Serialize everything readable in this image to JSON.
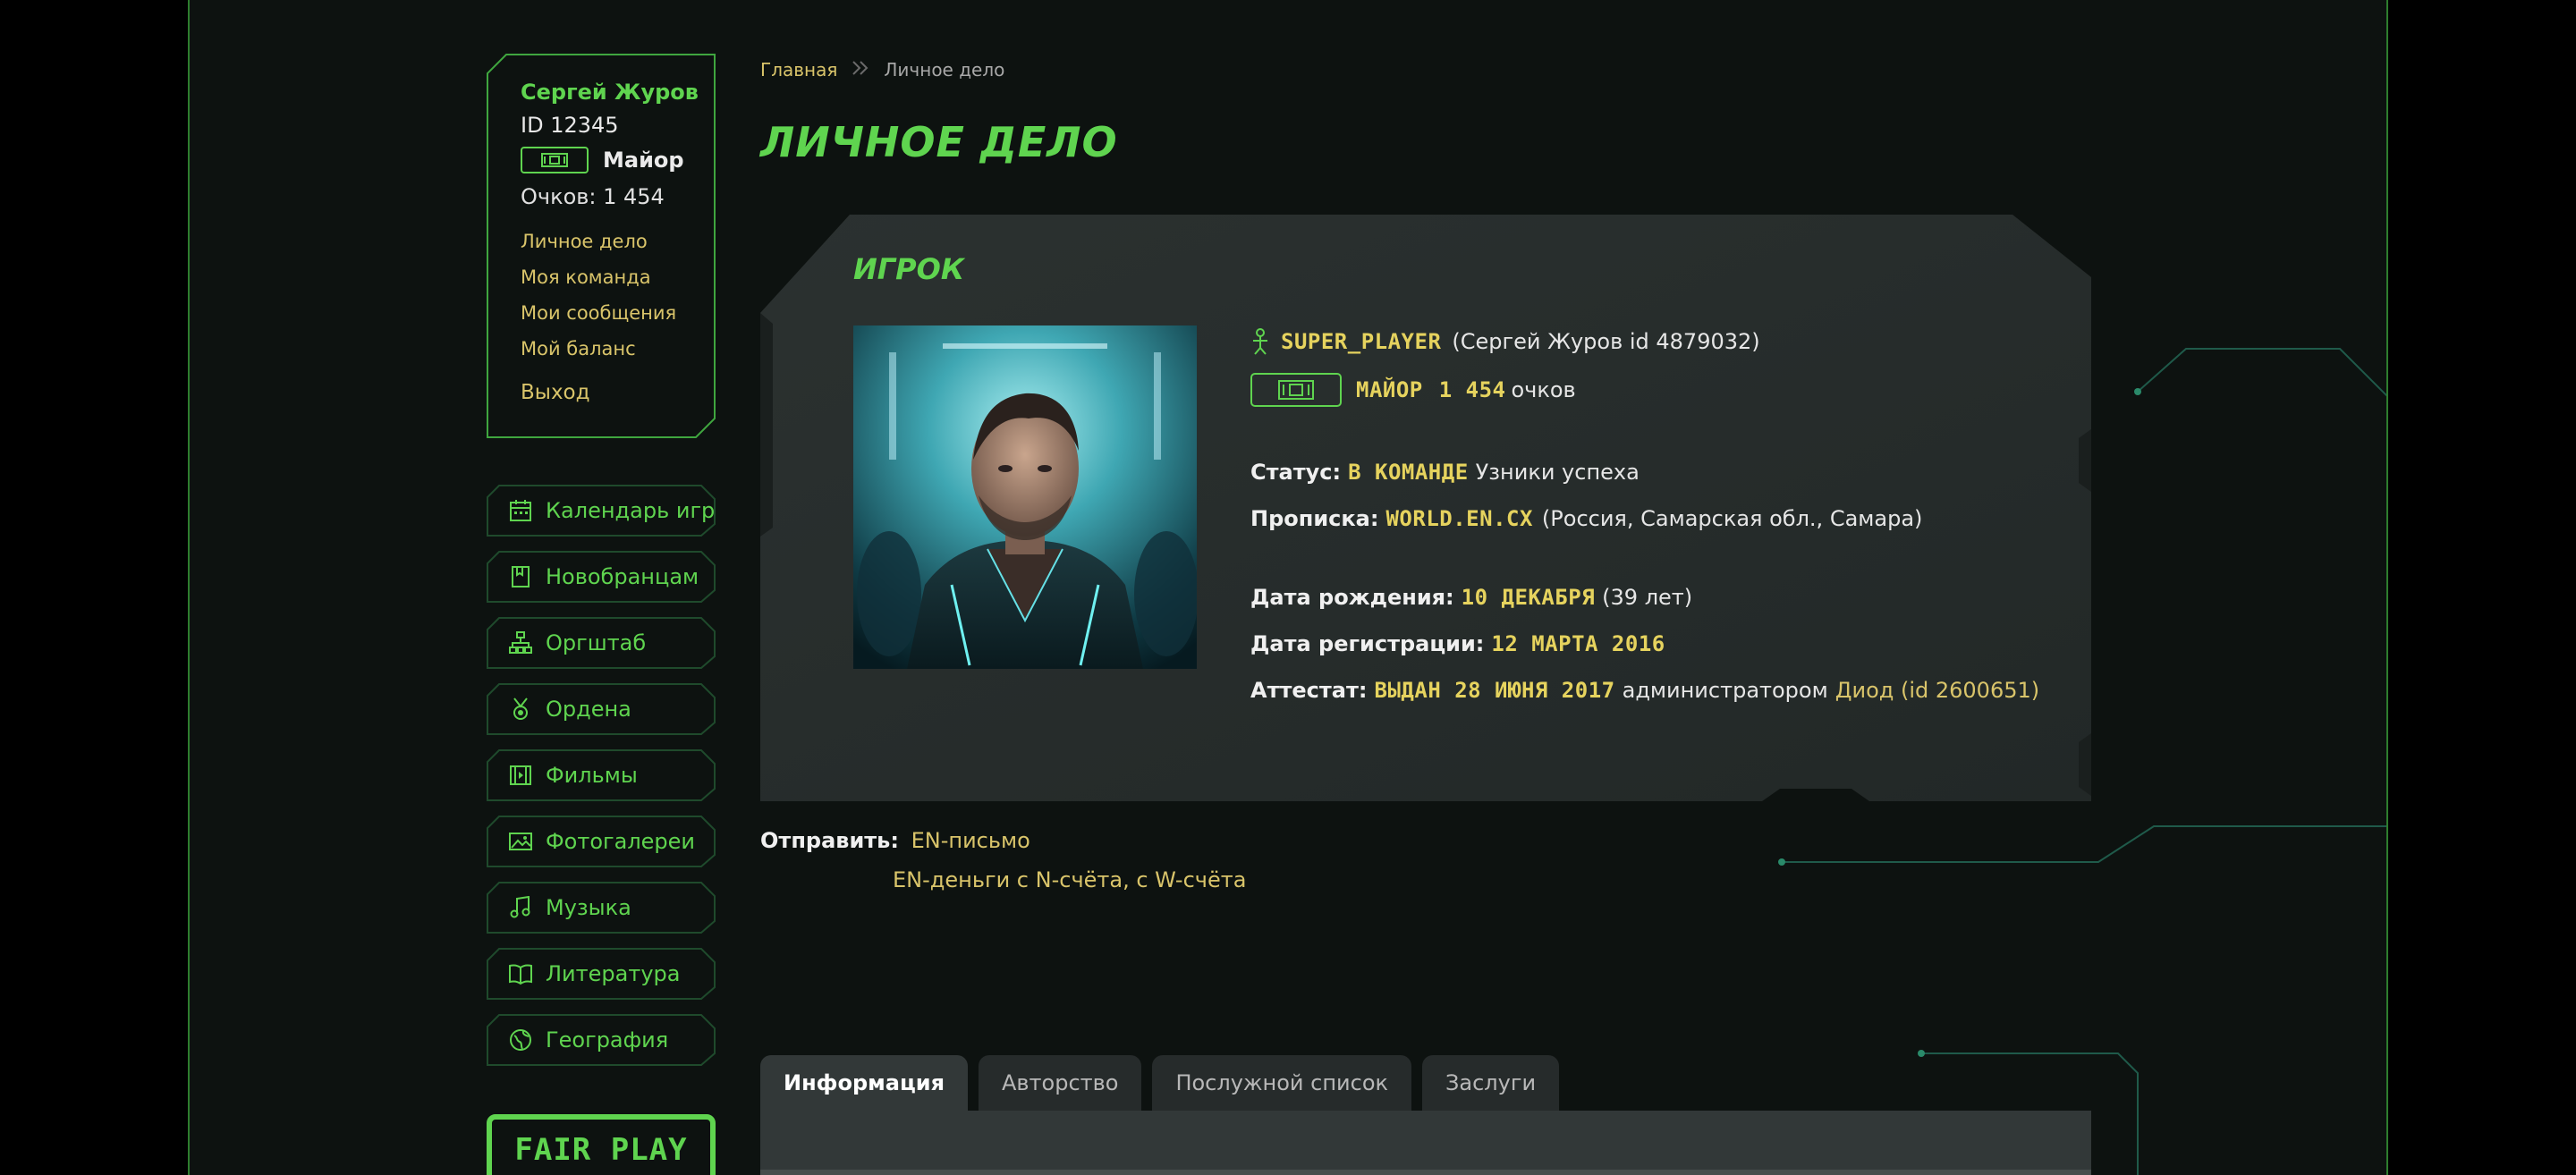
{
  "user": {
    "name": "Сергей Журов",
    "id": "ID 12345",
    "rank": "Майор",
    "points": "Очков: 1 454",
    "links": [
      "Личное дело",
      "Моя команда",
      "Мои сообщения",
      "Мой баланс"
    ],
    "logout": "Выход"
  },
  "nav": [
    {
      "label": "Календарь игр",
      "icon": "calendar-icon"
    },
    {
      "label": "Новобранцам",
      "icon": "bookmark-icon"
    },
    {
      "label": "Оргштаб",
      "icon": "org-chart-icon"
    },
    {
      "label": "Ордена",
      "icon": "medal-icon"
    },
    {
      "label": "Фильмы",
      "icon": "film-icon"
    },
    {
      "label": "Фотогалереи",
      "icon": "image-icon"
    },
    {
      "label": "Музыка",
      "icon": "music-note-icon"
    },
    {
      "label": "Литература",
      "icon": "book-icon"
    },
    {
      "label": "География",
      "icon": "globe-icon"
    }
  ],
  "fairplay": "FAIR PLAY",
  "breadcrumb": {
    "home": "Главная",
    "current": "Личное дело"
  },
  "page_title": "ЛИЧНОЕ ДЕЛО",
  "card": {
    "title": "ИГРОК",
    "nick": "SUPER_PLAYER",
    "nick_detail": "(Сергей Журов id 4879032)",
    "rank": "МАЙОР",
    "points": "1 454",
    "points_unit": "очков",
    "status_label": "Статус:",
    "status_value": "В КОМАНДЕ",
    "status_team": "Узники успеха",
    "domicile_label": "Прописка:",
    "domicile_value": "WORLD.EN.CX",
    "domicile_detail": "(Россия, Самарская обл., Самара)",
    "birth_label": "Дата рождения:",
    "birth_value": "10 ДЕКАБРЯ",
    "birth_age": "(39 лет)",
    "reg_label": "Дата регистрации:",
    "reg_value": "12 МАРТА 2016",
    "cert_label": "Аттестат:",
    "cert_value": "ВЫДАН 28 ИЮНЯ 2017",
    "cert_by": "администратором",
    "cert_admin": "Диод (id 2600651)"
  },
  "send": {
    "label": "Отправить:",
    "letter": "EN-письмо",
    "money": "EN-деньги с N-счёта, с W-счёта"
  },
  "tabs": [
    "Информация",
    "Авторство",
    "Послужной список",
    "Заслуги"
  ],
  "colors": {
    "accent": "#5fd44f",
    "gold": "#d9c46a",
    "yellow": "#e6d35e",
    "bg": "#0d1210"
  }
}
